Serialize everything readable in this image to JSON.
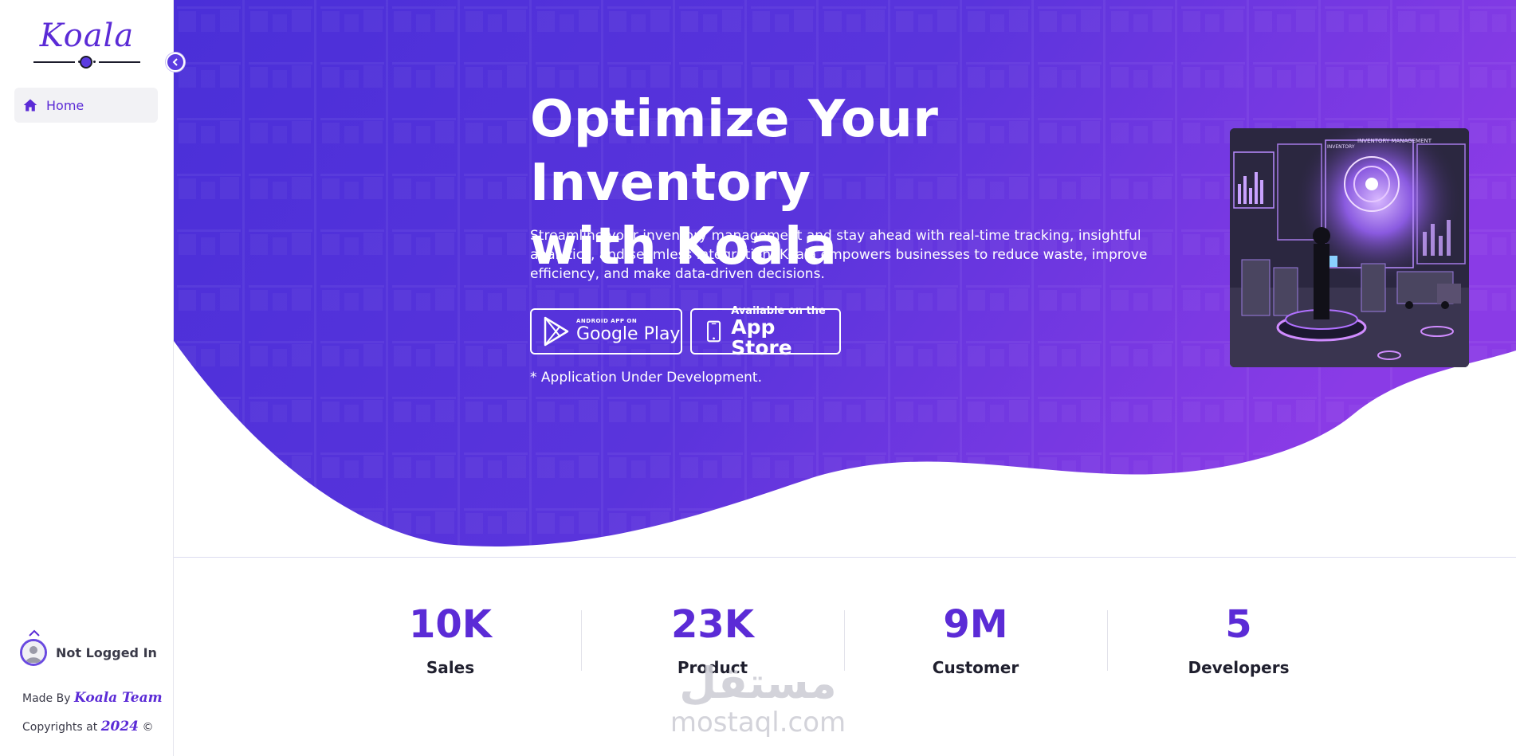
{
  "sidebar": {
    "logo_text": "Koala",
    "nav": [
      {
        "label": "Home",
        "icon": "home-icon"
      }
    ],
    "user": {
      "status": "Not Logged In"
    },
    "made_by_prefix": "Made By",
    "made_by_team": "Koala Team",
    "copyright_prefix": "Copyrights at",
    "copyright_year": "2024",
    "copyright_symbol": "©"
  },
  "hero": {
    "title_line1": "Optimize Your Inventory",
    "title_line2": "with Koala",
    "description": "Streamline your inventory management and stay ahead with real-time tracking, insightful analytics, and seamless integration. Koala empowers businesses to reduce waste, improve efficiency, and make data-driven decisions.",
    "google_play": {
      "small": "ANDROID APP ON",
      "big": "Google Play"
    },
    "app_store": {
      "small": "Available on the",
      "big": "App Store"
    },
    "note": "* Application Under Development.",
    "image_caption_1": "INVENTORY",
    "image_caption_2": "INVENTORY MANAGEMENT"
  },
  "stats": [
    {
      "value": "10K",
      "label": "Sales"
    },
    {
      "value": "23K",
      "label": "Product"
    },
    {
      "value": "9M",
      "label": "Customer"
    },
    {
      "value": "5",
      "label": "Developers"
    }
  ],
  "watermark": {
    "arabic": "مستقل",
    "latin": "mostaql.com"
  },
  "colors": {
    "accent": "#5b2bd6",
    "hero_start": "#4a2fd8",
    "hero_end": "#8a3be6"
  }
}
